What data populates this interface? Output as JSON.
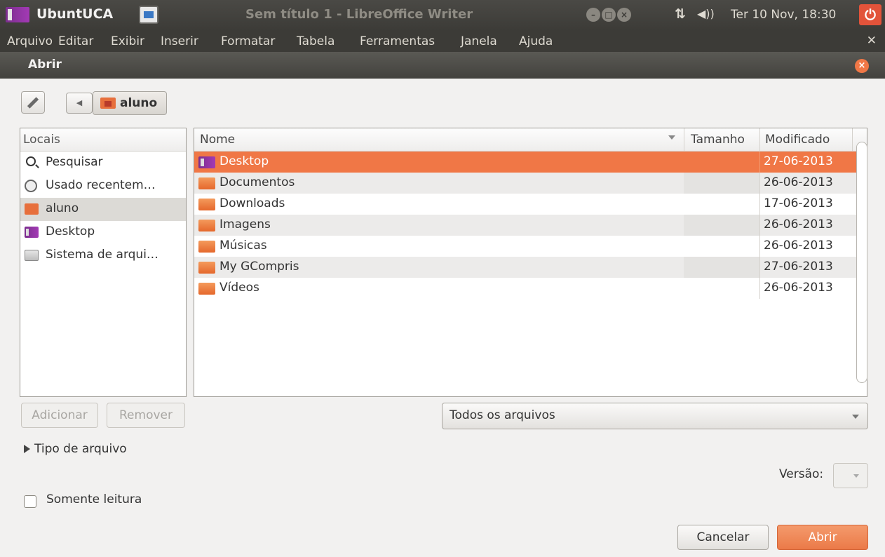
{
  "panel": {
    "app_name": "UbuntUCA",
    "window_title": "Sem título 1 - LibreOffice Writer",
    "clock": "Ter 10 Nov, 18:30"
  },
  "menubar": {
    "items": [
      "Arquivo",
      "Editar",
      "Exibir",
      "Inserir",
      "Formatar",
      "Tabela",
      "Ferramentas",
      "Janela",
      "Ajuda"
    ]
  },
  "dialog": {
    "title": "Abrir",
    "path_button": "aluno",
    "places_header": "Locais",
    "places": [
      {
        "label": "Pesquisar",
        "icon": "search-icon"
      },
      {
        "label": "Usado recentem…",
        "icon": "recent-icon"
      },
      {
        "label": "aluno",
        "icon": "home-folder-icon"
      },
      {
        "label": "Desktop",
        "icon": "desktop-icon"
      },
      {
        "label": "Sistema de arqui…",
        "icon": "drive-icon"
      }
    ],
    "columns": {
      "name": "Nome",
      "size": "Tamanho",
      "modified": "Modificado"
    },
    "files": [
      {
        "name": "Desktop",
        "modified": "27-06-2013"
      },
      {
        "name": "Documentos",
        "modified": "26-06-2013"
      },
      {
        "name": "Downloads",
        "modified": "17-06-2013"
      },
      {
        "name": "Imagens",
        "modified": "26-06-2013"
      },
      {
        "name": "Músicas",
        "modified": "26-06-2013"
      },
      {
        "name": "My GCompris",
        "modified": "27-06-2013"
      },
      {
        "name": "Vídeos",
        "modified": "26-06-2013"
      }
    ],
    "add_label": "Adicionar",
    "remove_label": "Remover",
    "filter_value": "Todos os arquivos",
    "file_type_expander": "Tipo de arquivo",
    "version_label": "Versão:",
    "readonly_label": "Somente leitura",
    "cancel_label": "Cancelar",
    "open_label": "Abrir"
  },
  "colors": {
    "accent": "#f07746",
    "panel": "#3c3b37"
  }
}
